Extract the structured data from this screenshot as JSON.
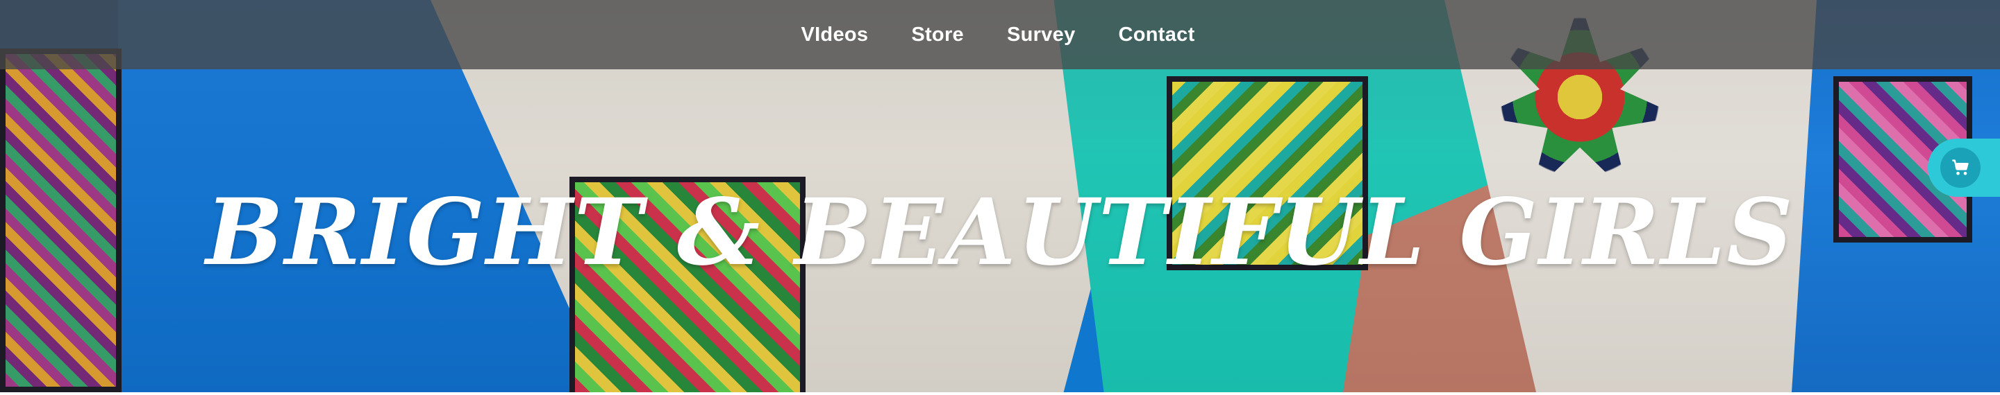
{
  "nav": {
    "items": [
      {
        "label": "VIdeos"
      },
      {
        "label": "Store"
      },
      {
        "label": "Survey"
      },
      {
        "label": "Contact"
      }
    ]
  },
  "hero": {
    "title": "BRIGHT & BEAUTIFUL GIRLS"
  },
  "cart": {
    "icon": "shopping-cart-icon"
  },
  "colors": {
    "topbar": "#484848",
    "cart_accent": "#2ec9d9",
    "title_text": "#ffffff"
  }
}
